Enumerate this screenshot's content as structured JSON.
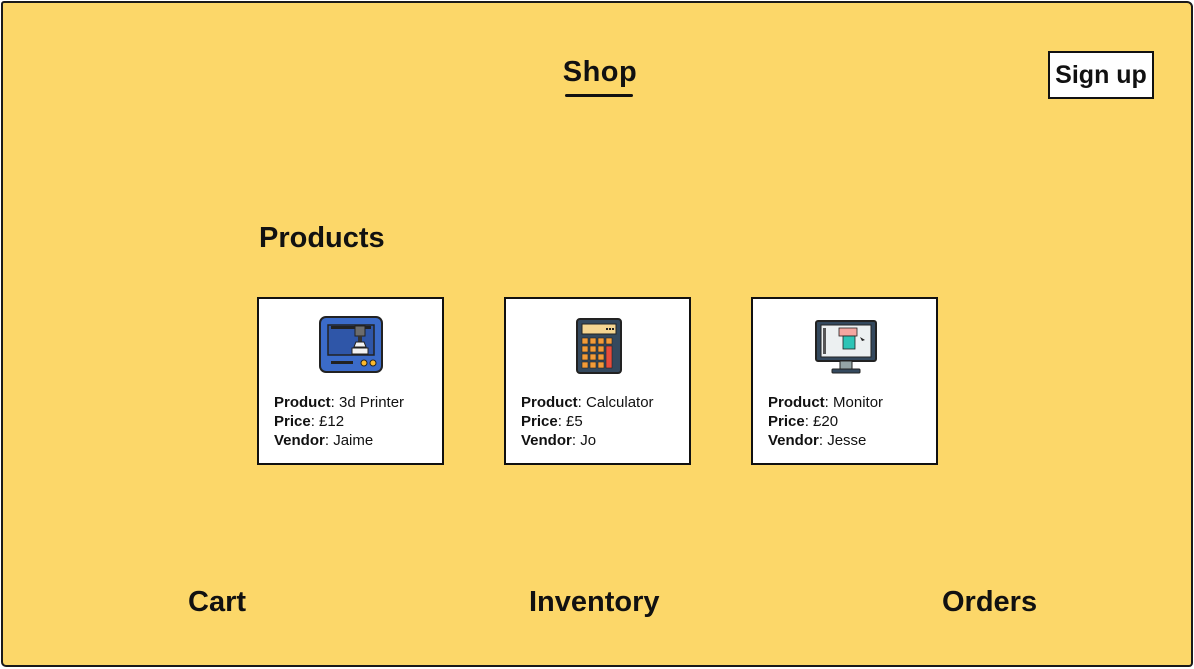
{
  "header": {
    "title": "Shop",
    "signup_label": "Sign up"
  },
  "products": {
    "heading": "Products",
    "field_labels": {
      "product": "Product",
      "price": "Price",
      "vendor": "Vendor"
    },
    "items": [
      {
        "icon": "3d-printer-icon",
        "product": "3d Printer",
        "price": "£12",
        "vendor": "Jaime"
      },
      {
        "icon": "calculator-icon",
        "product": "Calculator",
        "price": "£5",
        "vendor": "Jo"
      },
      {
        "icon": "monitor-icon",
        "product": "Monitor",
        "price": "£20",
        "vendor": "Jesse"
      }
    ]
  },
  "footer_nav": {
    "cart": "Cart",
    "inventory": "Inventory",
    "orders": "Orders"
  },
  "colors": {
    "background": "#FCD769",
    "card_background": "#FFFFFF",
    "text": "#111111"
  }
}
